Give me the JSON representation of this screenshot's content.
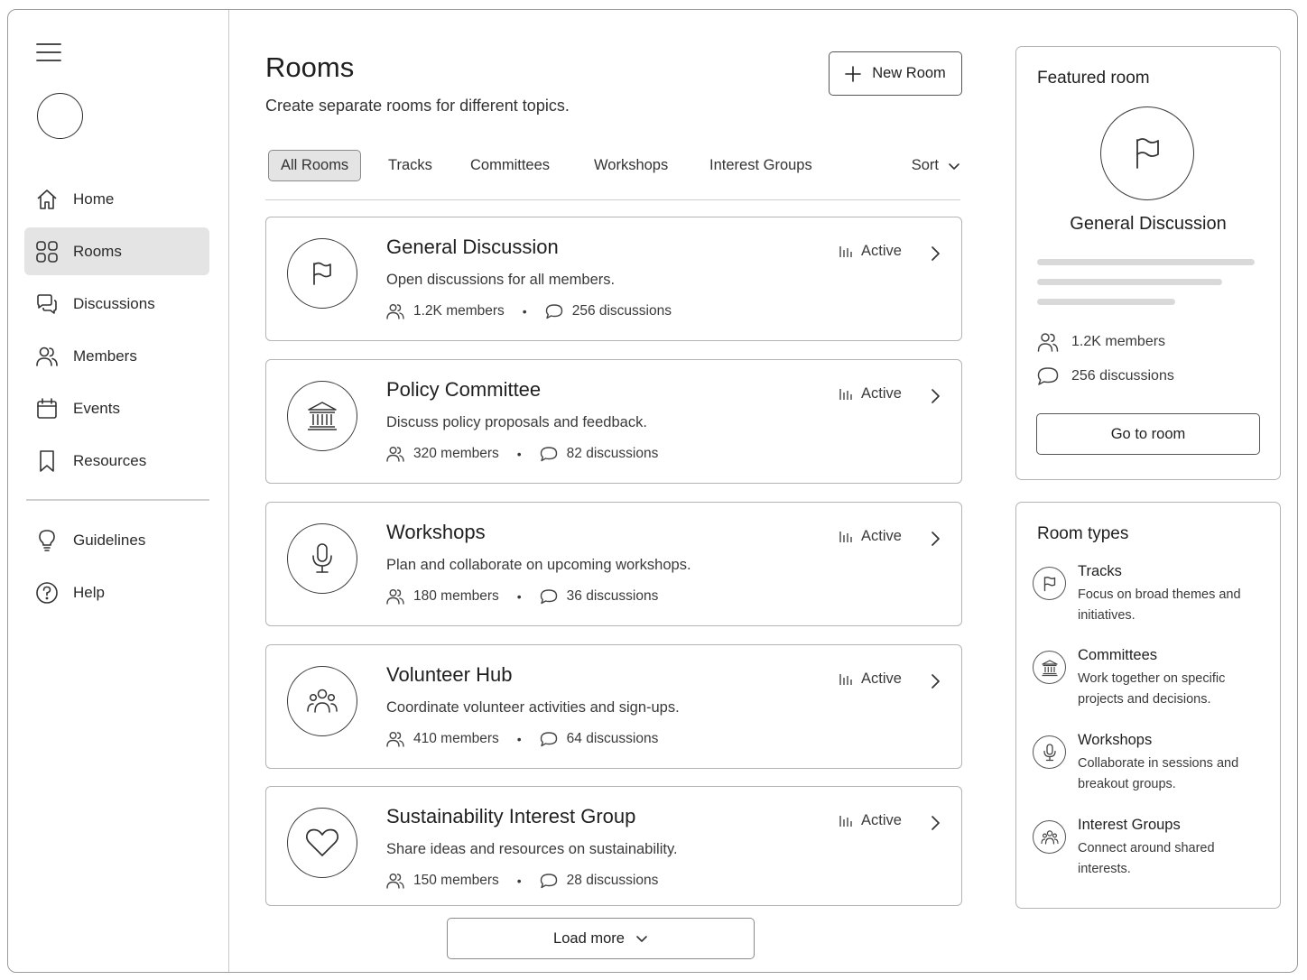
{
  "sidebar": {
    "items": [
      {
        "label": "Home",
        "icon": "home-icon"
      },
      {
        "label": "Rooms",
        "icon": "grid-icon",
        "active": true
      },
      {
        "label": "Discussions",
        "icon": "chat-bubbles-icon"
      },
      {
        "label": "Members",
        "icon": "users-icon"
      },
      {
        "label": "Events",
        "icon": "calendar-icon"
      },
      {
        "label": "Resources",
        "icon": "bookmark-icon"
      }
    ],
    "secondary": [
      {
        "label": "Guidelines",
        "icon": "lightbulb-icon"
      },
      {
        "label": "Help",
        "icon": "help-circle-icon"
      }
    ]
  },
  "header": {
    "title": "Rooms",
    "subtitle": "Create separate rooms for different topics.",
    "new_room_label": "New Room"
  },
  "tabs": [
    {
      "label": "All Rooms",
      "active": true
    },
    {
      "label": "Tracks"
    },
    {
      "label": "Committees"
    },
    {
      "label": "Workshops"
    },
    {
      "label": "Interest Groups"
    }
  ],
  "sort_label": "Sort",
  "rooms": [
    {
      "name": "General Discussion",
      "description": "Open discussions for all members.",
      "members": "1.2K members",
      "discussions": "256 discussions",
      "status": "Active",
      "icon": "flag-icon"
    },
    {
      "name": "Policy Committee",
      "description": "Discuss policy proposals and feedback.",
      "members": "320 members",
      "discussions": "82 discussions",
      "status": "Active",
      "icon": "institution-icon"
    },
    {
      "name": "Workshops",
      "description": "Plan and collaborate on upcoming workshops.",
      "members": "180 members",
      "discussions": "36 discussions",
      "status": "Active",
      "icon": "microphone-icon"
    },
    {
      "name": "Volunteer Hub",
      "description": "Coordinate volunteer activities and sign-ups.",
      "members": "410 members",
      "discussions": "64 discussions",
      "status": "Active",
      "icon": "group-icon"
    },
    {
      "name": "Sustainability Interest Group",
      "description": "Share ideas and resources on sustainability.",
      "members": "150 members",
      "discussions": "28 discussions",
      "status": "Active",
      "icon": "heart-icon"
    }
  ],
  "load_more_label": "Load more",
  "featured": {
    "title": "Featured room",
    "name": "General Discussion",
    "members": "1.2K members",
    "discussions": "256 discussions",
    "button_label": "Go to room",
    "icon": "flag-icon"
  },
  "room_types": {
    "title": "Room types",
    "items": [
      {
        "name": "Tracks",
        "description": "Focus on broad themes and initiatives.",
        "icon": "flag-icon"
      },
      {
        "name": "Committees",
        "description": "Work together on specific projects and decisions.",
        "icon": "institution-icon"
      },
      {
        "name": "Workshops",
        "description": "Collaborate in sessions and breakout groups.",
        "icon": "microphone-icon"
      },
      {
        "name": "Interest Groups",
        "description": "Connect around shared interests.",
        "icon": "group-icon"
      }
    ]
  }
}
